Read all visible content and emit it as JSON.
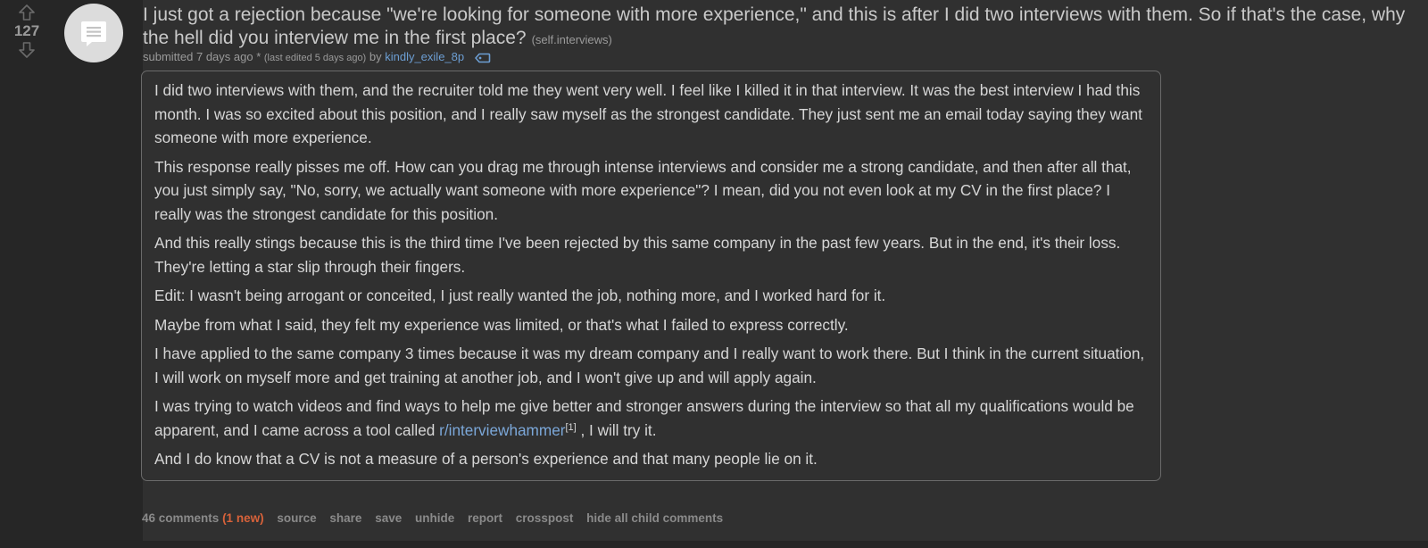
{
  "post": {
    "score": "127",
    "title": "I just got a rejection because \"we're looking for someone with more experience,\" and this is after I did two interviews with them. So if that's the case, why the hell did you interview me in the first place?",
    "domain": "(self.interviews)",
    "tagline": {
      "submitted": "submitted 7 days ago *",
      "edited": "(last edited 5 days ago)",
      "by": "by",
      "author": "kindly_exile_8p"
    },
    "paragraphs": [
      "I did two interviews with them, and the recruiter told me they went very well. I feel like I killed it in that interview. It was the best interview I had this month. I was so excited about this position, and I really saw myself as the strongest candidate. They just sent me an email today saying they want someone with more experience.",
      "This response really pisses me off. How can you drag me through intense interviews and consider me a strong candidate, and then after all that, you just simply say, \"No, sorry, we actually want someone with more experience\"? I mean, did you not even look at my CV in the first place? I really was the strongest candidate for this position.",
      "And this really stings because this is the third time I've been rejected by this same company in the past few years. But in the end, it's their loss. They're letting a star slip through their fingers.",
      "Edit: I wasn't being arrogant or conceited, I just really wanted the job, nothing more, and I worked hard for it.",
      "Maybe from what I said, they felt my experience was limited, or that's what I failed to express correctly.",
      "I have applied to the same company 3 times because it was my dream company and I really want to work there. But I think in the current situation, I will work on myself more and get training at another job, and I won't give up and will apply again."
    ],
    "link_paragraph": {
      "before": "I was trying to watch videos and find ways to help me give better and stronger answers during the interview so that all my qualifications would be apparent, and I came across a tool called ",
      "link_text": "r/interviewhammer",
      "footnote": "[1]",
      "after": " , I will try it."
    },
    "last_paragraph": "And I do know that a CV is not a measure of a person's experience and that many people lie on it.",
    "buttons": {
      "comments": "46 comments",
      "new": "(1 new)",
      "source": "source",
      "share": "share",
      "save": "save",
      "unhide": "unhide",
      "report": "report",
      "crosspost": "crosspost",
      "hide_children": "hide all child comments"
    }
  },
  "colors": {
    "page_bg": "#262626",
    "post_bg": "#303030",
    "text": "#d6d6d6",
    "link": "#7ba7d8",
    "author": "#6c9ed3",
    "new_comments": "#d8623a",
    "muted": "#8a8a8a"
  },
  "icons": {
    "upvote": "up-arrow-icon",
    "downvote": "down-arrow-icon",
    "thumbnail": "self-post-icon",
    "flair": "tag-icon"
  }
}
